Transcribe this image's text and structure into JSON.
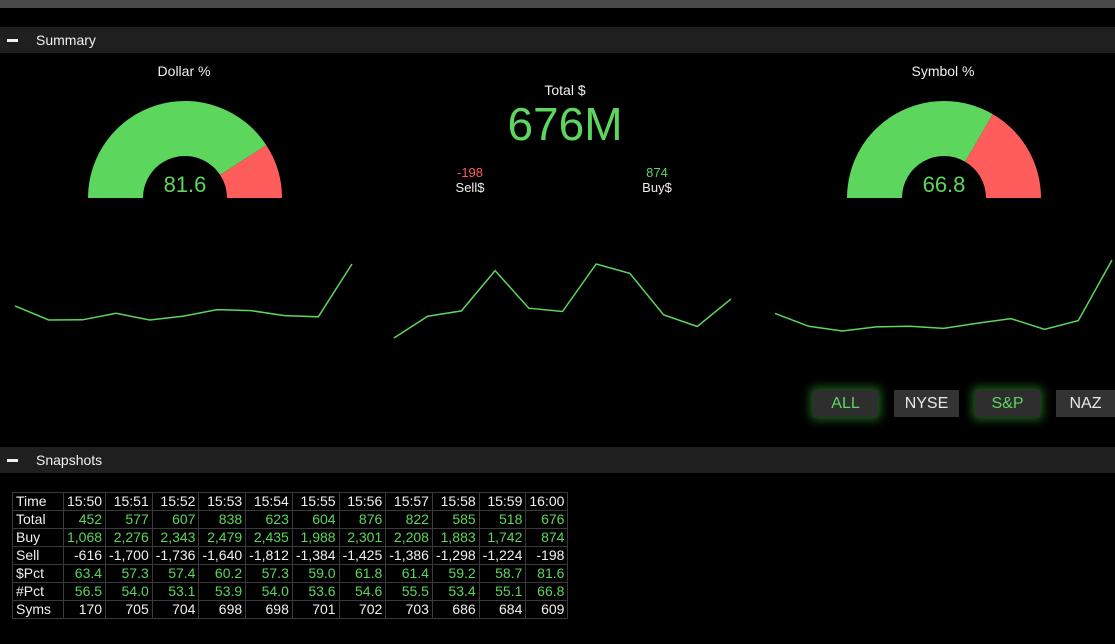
{
  "colors": {
    "green": "#5dd65d",
    "red": "#ff5c5c",
    "background": "#000000",
    "panel": "#1f1f1f"
  },
  "summary": {
    "section_title": "Summary",
    "dollar_gauge": {
      "title": "Dollar %",
      "value": "81.6",
      "percent": 81.6
    },
    "symbol_gauge": {
      "title": "Symbol %",
      "value": "66.8",
      "percent": 66.8
    },
    "total": {
      "label": "Total $",
      "value": "676M"
    },
    "sell": {
      "value": "-198",
      "label": "Sell$"
    },
    "buy": {
      "value": "874",
      "label": "Buy$"
    },
    "sparklines": [
      {
        "name": "dollar-pct",
        "values": [
          63.4,
          57.3,
          57.4,
          60.2,
          57.3,
          59.0,
          61.8,
          61.4,
          59.2,
          58.7,
          81.6
        ]
      },
      {
        "name": "total",
        "values": [
          452,
          577,
          607,
          838,
          623,
          604,
          876,
          822,
          585,
          518,
          676
        ]
      },
      {
        "name": "symbol-pct",
        "values": [
          56.5,
          54.0,
          53.1,
          53.9,
          54.0,
          53.6,
          54.6,
          55.5,
          53.4,
          55.1,
          66.8
        ]
      }
    ],
    "filters": [
      {
        "label": "ALL",
        "active": true
      },
      {
        "label": "NYSE",
        "active": false
      },
      {
        "label": "S&P",
        "active": true
      },
      {
        "label": "NAZ",
        "active": false
      }
    ]
  },
  "snapshots": {
    "section_title": "Snapshots",
    "rows": [
      {
        "label": "Time",
        "cells": [
          "15:50",
          "15:51",
          "15:52",
          "15:53",
          "15:54",
          "15:55",
          "15:56",
          "15:57",
          "15:58",
          "15:59",
          "16:00"
        ],
        "color": "white"
      },
      {
        "label": "Total",
        "cells": [
          "452",
          "577",
          "607",
          "838",
          "623",
          "604",
          "876",
          "822",
          "585",
          "518",
          "676"
        ],
        "color": "green"
      },
      {
        "label": "Buy",
        "cells": [
          "1,068",
          "2,276",
          "2,343",
          "2,479",
          "2,435",
          "1,988",
          "2,301",
          "2,208",
          "1,883",
          "1,742",
          "874"
        ],
        "color": "green"
      },
      {
        "label": "Sell",
        "cells": [
          "-616",
          "-1,700",
          "-1,736",
          "-1,640",
          "-1,812",
          "-1,384",
          "-1,425",
          "-1,386",
          "-1,298",
          "-1,224",
          "-198"
        ],
        "color": "white"
      },
      {
        "label": "$Pct",
        "cells": [
          "63.4",
          "57.3",
          "57.4",
          "60.2",
          "57.3",
          "59.0",
          "61.8",
          "61.4",
          "59.2",
          "58.7",
          "81.6"
        ],
        "color": "green"
      },
      {
        "label": "#Pct",
        "cells": [
          "56.5",
          "54.0",
          "53.1",
          "53.9",
          "54.0",
          "53.6",
          "54.6",
          "55.5",
          "53.4",
          "55.1",
          "66.8"
        ],
        "color": "green"
      },
      {
        "label": "Syms",
        "cells": [
          "170",
          "705",
          "704",
          "698",
          "698",
          "701",
          "702",
          "703",
          "686",
          "684",
          "609"
        ],
        "color": "white"
      }
    ]
  }
}
